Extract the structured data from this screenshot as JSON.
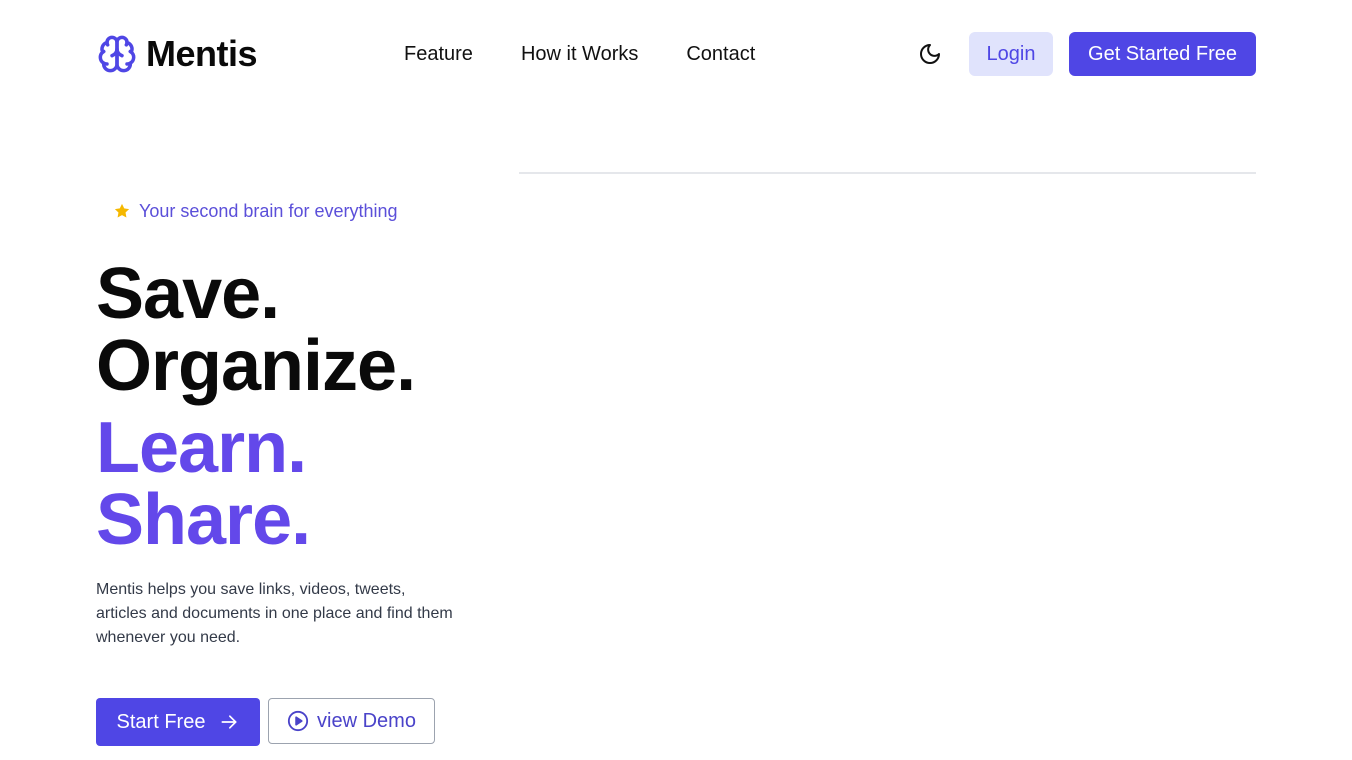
{
  "brand": {
    "name": "Mentis",
    "icon": "brain-icon",
    "accent_color": "#4f46e5"
  },
  "nav": {
    "links": [
      {
        "label": "Feature"
      },
      {
        "label": "How it Works"
      },
      {
        "label": "Contact"
      }
    ],
    "theme_toggle_icon": "moon-icon",
    "login_label": "Login",
    "cta_label": "Get Started Free"
  },
  "hero": {
    "tagline": "Your second brain for everything",
    "tagline_icon": "star-icon",
    "headline": {
      "line1": "Save.",
      "line2": "Organize.",
      "line3": "Learn.",
      "line4": "Share."
    },
    "description": "Mentis helps you save links, videos, tweets, articles and documents in one place and find them whenever you need.",
    "primary_button": {
      "label": "Start Free",
      "icon": "arrow-right-icon"
    },
    "secondary_button": {
      "label": "view Demo",
      "icon": "play-circle-icon"
    }
  },
  "colors": {
    "primary": "#4f46e5",
    "headline_accent": "#6348ea",
    "login_bg": "#e0e3fc",
    "star": "#f5b800"
  }
}
